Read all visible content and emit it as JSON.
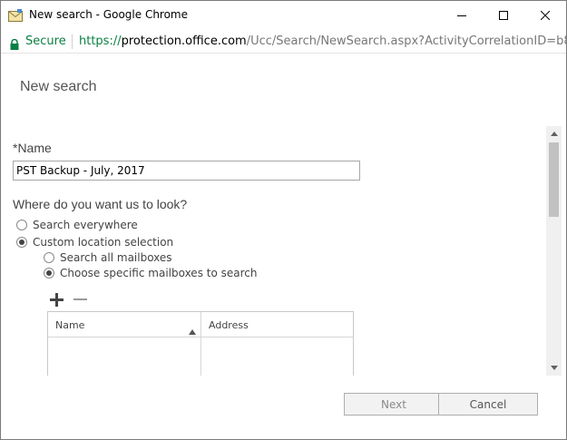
{
  "window": {
    "title": "New search - Google Chrome"
  },
  "addressbar": {
    "secure_label": "Secure",
    "url_scheme": "https://",
    "url_host": "protection.office.com",
    "url_path": "/Ucc/Search/NewSearch.aspx?ActivityCorrelationID=b8084"
  },
  "page": {
    "title": "New search"
  },
  "form": {
    "name_label": "*Name",
    "name_value": "PST Backup - July, 2017",
    "look_label": "Where do you want us to look?",
    "location_options": [
      {
        "label": "Search everywhere",
        "checked": false
      },
      {
        "label": "Custom location selection",
        "checked": true
      }
    ],
    "mailbox_options": [
      {
        "label": "Search all mailboxes",
        "checked": false
      },
      {
        "label": "Choose specific mailboxes to search",
        "checked": true
      }
    ],
    "grid": {
      "columns": [
        "Name",
        "Address"
      ],
      "rows": []
    }
  },
  "footer": {
    "next_label": "Next",
    "cancel_label": "Cancel"
  },
  "icons": {
    "app": "envelope-icon",
    "secure": "lock-icon",
    "add": "plus-icon",
    "remove": "minus-icon",
    "sort": "sort-ascending-icon"
  },
  "colors": {
    "secure_green": "#0b8043",
    "border": "#a6a6a6"
  }
}
